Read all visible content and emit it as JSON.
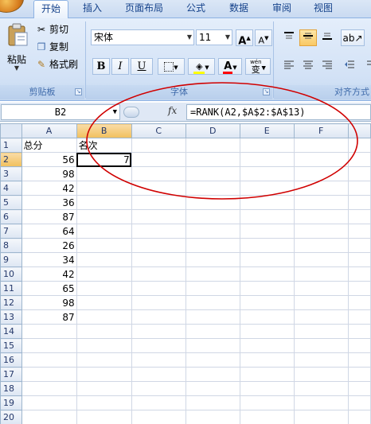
{
  "ribbon": {
    "tabs": [
      {
        "label": "开始",
        "active": true
      },
      {
        "label": "插入",
        "active": false
      },
      {
        "label": "页面布局",
        "active": false
      },
      {
        "label": "公式",
        "active": false
      },
      {
        "label": "数据",
        "active": false
      },
      {
        "label": "审阅",
        "active": false
      },
      {
        "label": "视图",
        "active": false
      }
    ],
    "clipboard": {
      "paste_label": "粘贴",
      "cut_label": "剪切",
      "copy_label": "复制",
      "format_painter_label": "格式刷",
      "group_label": "剪贴板"
    },
    "font": {
      "font_name": "宋体",
      "font_size": "11",
      "grow_label": "A",
      "shrink_label": "A",
      "bold_label": "B",
      "italic_label": "I",
      "underline_label": "U",
      "font_color_label": "A",
      "phonetic_label": "wén",
      "phonetic_char": "变",
      "group_label": "字体"
    },
    "alignment": {
      "group_label": "对齐方式"
    },
    "colors": {
      "fill_highlight": "#ffff00",
      "font_color": "#ff0000"
    }
  },
  "formula_bar": {
    "name_box": "B2",
    "fx_label": "fx",
    "formula": "=RANK(A2,$A$2:$A$13)"
  },
  "sheet": {
    "columns": [
      "A",
      "B",
      "C",
      "D",
      "E",
      "F"
    ],
    "selected_column": "B",
    "selected_row": "2",
    "rows": [
      {
        "num": "1",
        "cells": [
          "总分",
          "名次",
          "",
          "",
          "",
          ""
        ]
      },
      {
        "num": "2",
        "cells": [
          "56",
          "7",
          "",
          "",
          "",
          ""
        ]
      },
      {
        "num": "3",
        "cells": [
          "98",
          "",
          "",
          "",
          "",
          ""
        ]
      },
      {
        "num": "4",
        "cells": [
          "42",
          "",
          "",
          "",
          "",
          ""
        ]
      },
      {
        "num": "5",
        "cells": [
          "36",
          "",
          "",
          "",
          "",
          ""
        ]
      },
      {
        "num": "6",
        "cells": [
          "87",
          "",
          "",
          "",
          "",
          ""
        ]
      },
      {
        "num": "7",
        "cells": [
          "64",
          "",
          "",
          "",
          "",
          ""
        ]
      },
      {
        "num": "8",
        "cells": [
          "26",
          "",
          "",
          "",
          "",
          ""
        ]
      },
      {
        "num": "9",
        "cells": [
          "34",
          "",
          "",
          "",
          "",
          ""
        ]
      },
      {
        "num": "10",
        "cells": [
          "42",
          "",
          "",
          "",
          "",
          ""
        ]
      },
      {
        "num": "11",
        "cells": [
          "65",
          "",
          "",
          "",
          "",
          ""
        ]
      },
      {
        "num": "12",
        "cells": [
          "98",
          "",
          "",
          "",
          "",
          ""
        ]
      },
      {
        "num": "13",
        "cells": [
          "87",
          "",
          "",
          "",
          "",
          ""
        ]
      },
      {
        "num": "14",
        "cells": [
          "",
          "",
          "",
          "",
          "",
          ""
        ]
      },
      {
        "num": "15",
        "cells": [
          "",
          "",
          "",
          "",
          "",
          ""
        ]
      },
      {
        "num": "16",
        "cells": [
          "",
          "",
          "",
          "",
          "",
          ""
        ]
      },
      {
        "num": "17",
        "cells": [
          "",
          "",
          "",
          "",
          "",
          ""
        ]
      },
      {
        "num": "18",
        "cells": [
          "",
          "",
          "",
          "",
          "",
          ""
        ]
      },
      {
        "num": "19",
        "cells": [
          "",
          "",
          "",
          "",
          "",
          ""
        ]
      },
      {
        "num": "20",
        "cells": [
          "",
          "",
          "",
          "",
          "",
          ""
        ]
      }
    ]
  },
  "annotation": {
    "ellipse_color": "#d00000"
  }
}
